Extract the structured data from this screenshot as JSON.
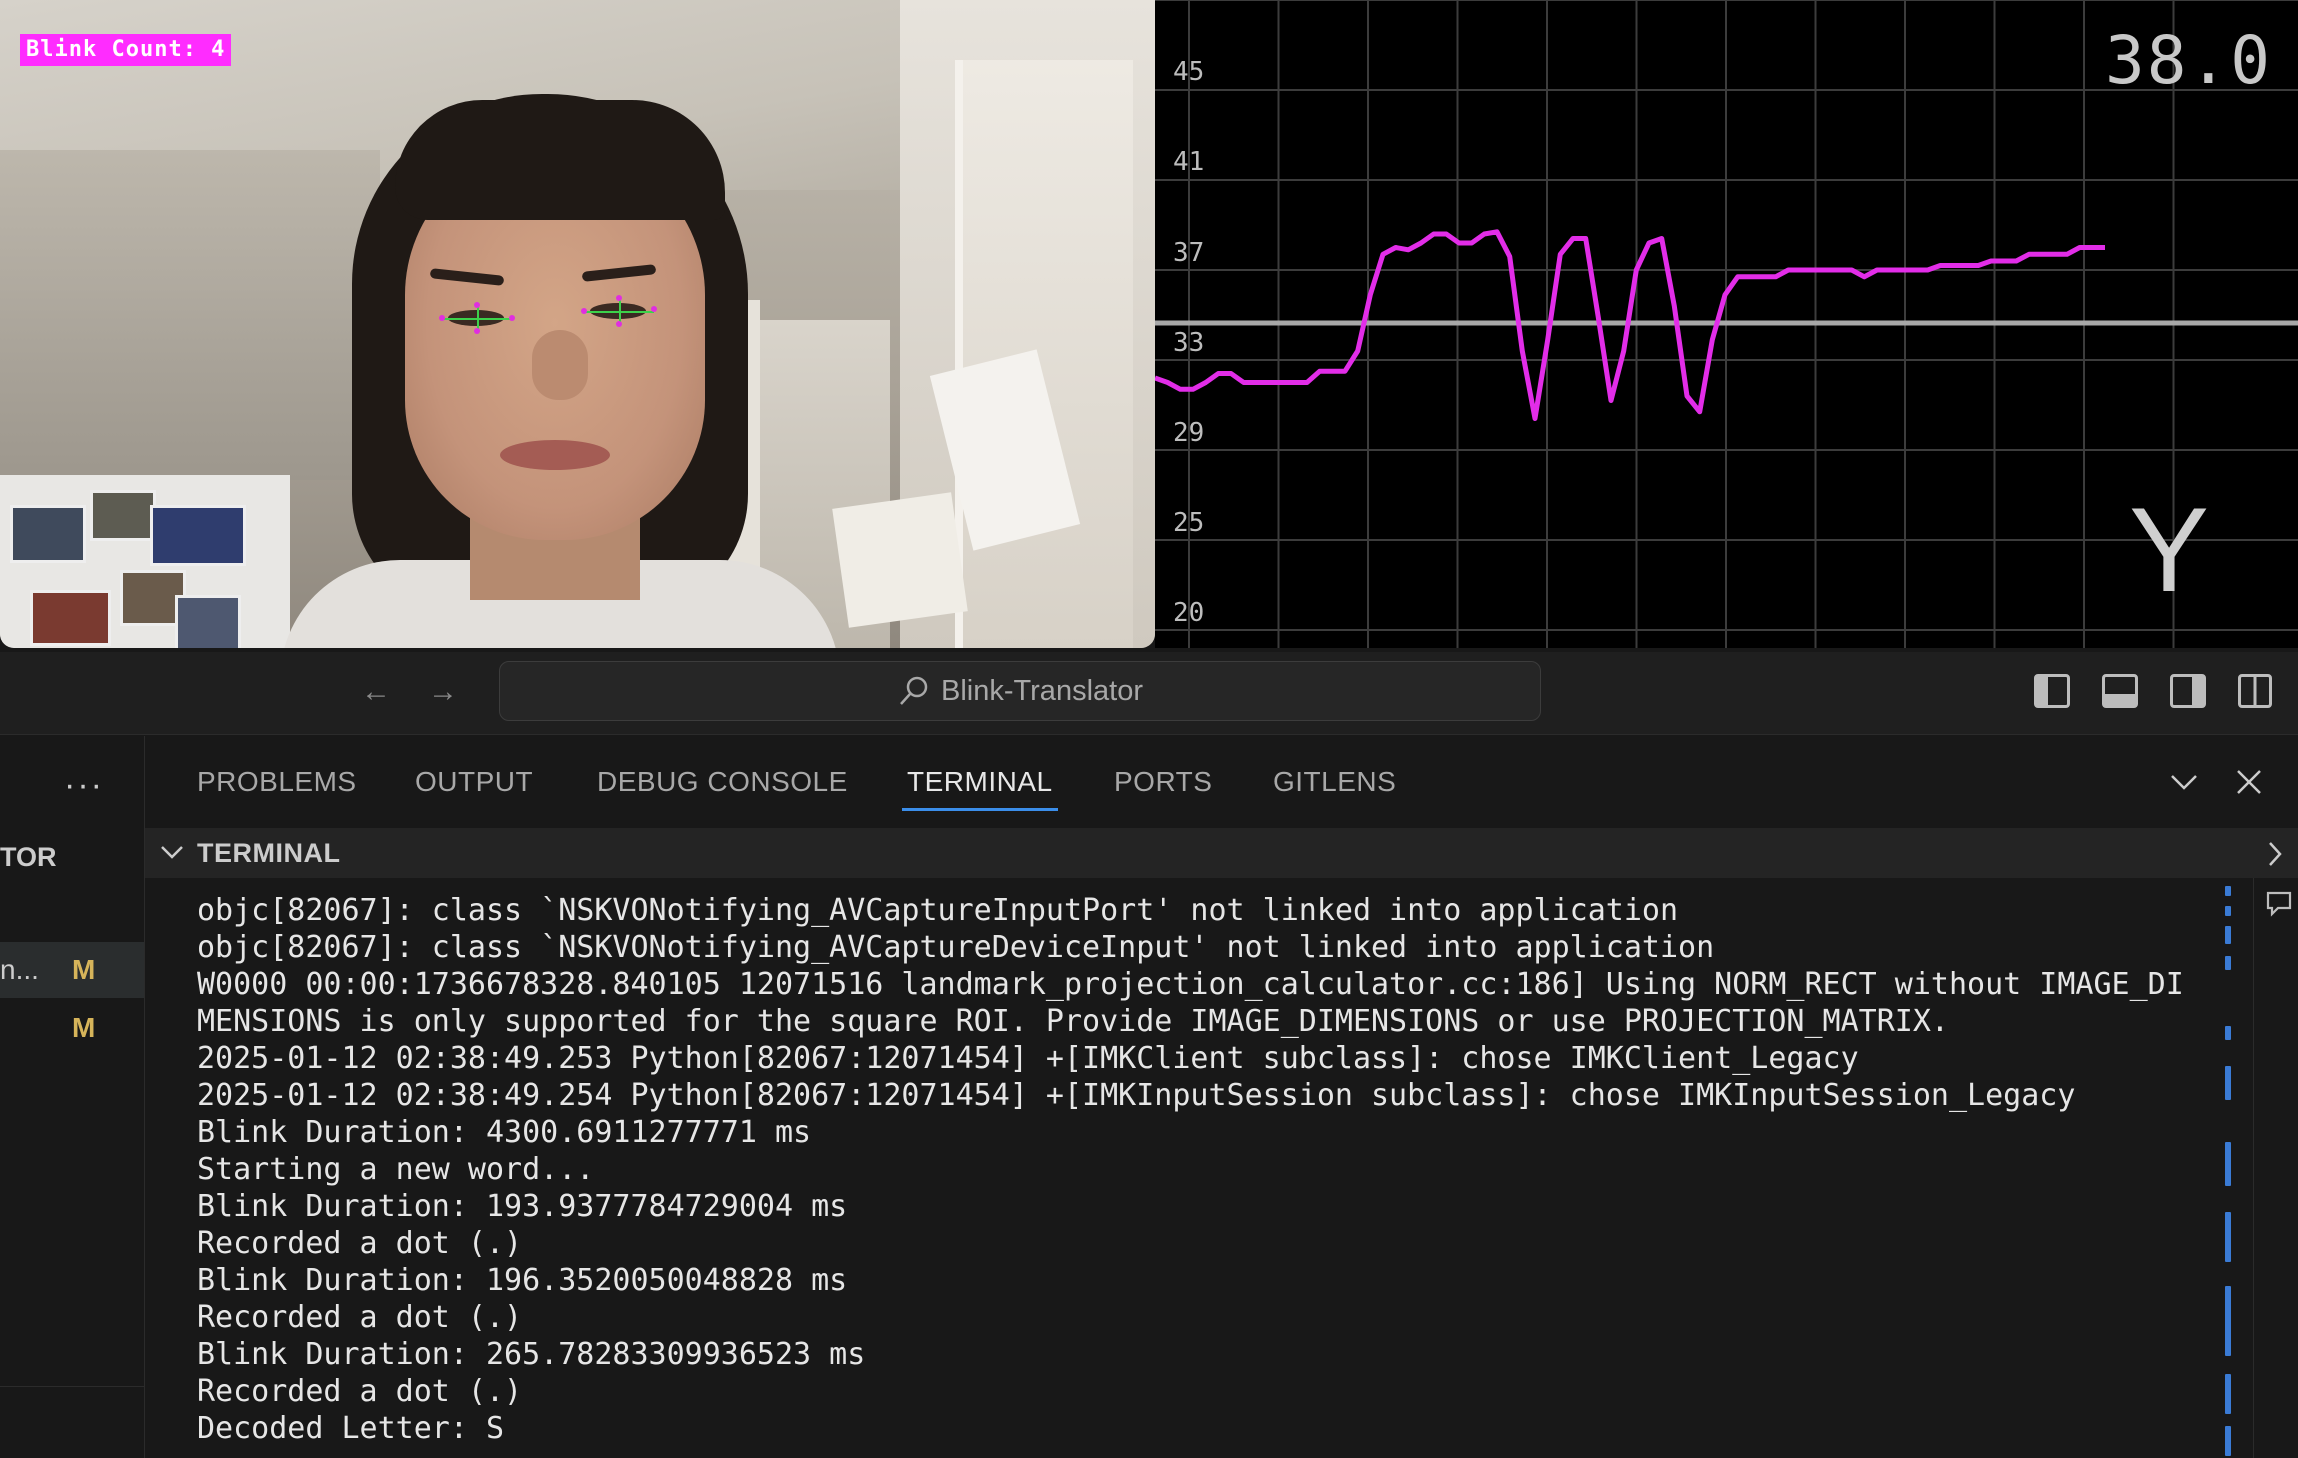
{
  "camera": {
    "blink_label": "Blink Count: 4"
  },
  "graph": {
    "value_readout": "38.0",
    "current_letter": "Y",
    "y_ticks": [
      "45",
      "41",
      "37",
      "33",
      "29",
      "25",
      "20"
    ],
    "line_color": "#e22de8",
    "threshold_color": "#a8a8a8",
    "chart_data": {
      "type": "line",
      "ylim": [
        20,
        47
      ],
      "threshold": 34.2,
      "series": [
        {
          "values": [
            31.8,
            31.6,
            31.3,
            31.3,
            31.6,
            32.0,
            32.0,
            31.6,
            31.6,
            31.6,
            31.6,
            31.6,
            31.6,
            32.1,
            32.1,
            32.1,
            33.0,
            35.5,
            37.3,
            37.6,
            37.5,
            37.8,
            38.2,
            38.2,
            37.8,
            37.8,
            38.2,
            38.3,
            37.2,
            33.0,
            30.0,
            33.5,
            37.3,
            38.0,
            38.0,
            34.5,
            30.8,
            33.0,
            36.6,
            37.8,
            38.0,
            35.0,
            31.0,
            30.3,
            33.5,
            35.5,
            36.3,
            36.3,
            36.3,
            36.3,
            36.6,
            36.6,
            36.6,
            36.6,
            36.6,
            36.6,
            36.3,
            36.6,
            36.6,
            36.6,
            36.6,
            36.6,
            36.8,
            36.8,
            36.8,
            36.8,
            37.0,
            37.0,
            37.0,
            37.3,
            37.3,
            37.3,
            37.3,
            37.6,
            37.6,
            37.6
          ]
        }
      ]
    }
  },
  "titlebar": {
    "back_icon": "arrow-left-icon",
    "forward_icon": "arrow-right-icon",
    "search_text": "Blink-Translator"
  },
  "sidebar": {
    "section_label": "TOR",
    "items": [
      {
        "name": "n...",
        "flag": "M"
      },
      {
        "name": "",
        "flag": "M"
      }
    ]
  },
  "panel": {
    "tabs": [
      "PROBLEMS",
      "OUTPUT",
      "DEBUG CONSOLE",
      "TERMINAL",
      "PORTS",
      "GITLENS"
    ],
    "active_tab": "TERMINAL",
    "section_header": "TERMINAL",
    "accent_color": "#3b8eea"
  },
  "terminal": {
    "lines": [
      "objc[82067]: class `NSKVONotifying_AVCaptureInputPort' not linked into application",
      "objc[82067]: class `NSKVONotifying_AVCaptureDeviceInput' not linked into application",
      "W0000 00:00:1736678328.840105 12071516 landmark_projection_calculator.cc:186] Using NORM_RECT without IMAGE_DI",
      "MENSIONS is only supported for the square ROI. Provide IMAGE_DIMENSIONS or use PROJECTION_MATRIX.",
      "2025-01-12 02:38:49.253 Python[82067:12071454] +[IMKClient subclass]: chose IMKClient_Legacy",
      "2025-01-12 02:38:49.254 Python[82067:12071454] +[IMKInputSession subclass]: chose IMKInputSession_Legacy",
      "Blink Duration: 4300.6911277771 ms",
      "Starting a new word...",
      "Blink Duration: 193.9377784729004 ms",
      "Recorded a dot (.)",
      "Blink Duration: 196.3520050048828 ms",
      "Recorded a dot (.)",
      "Blink Duration: 265.78283309936523 ms",
      "Recorded a dot (.)",
      "Decoded Letter: S"
    ]
  }
}
